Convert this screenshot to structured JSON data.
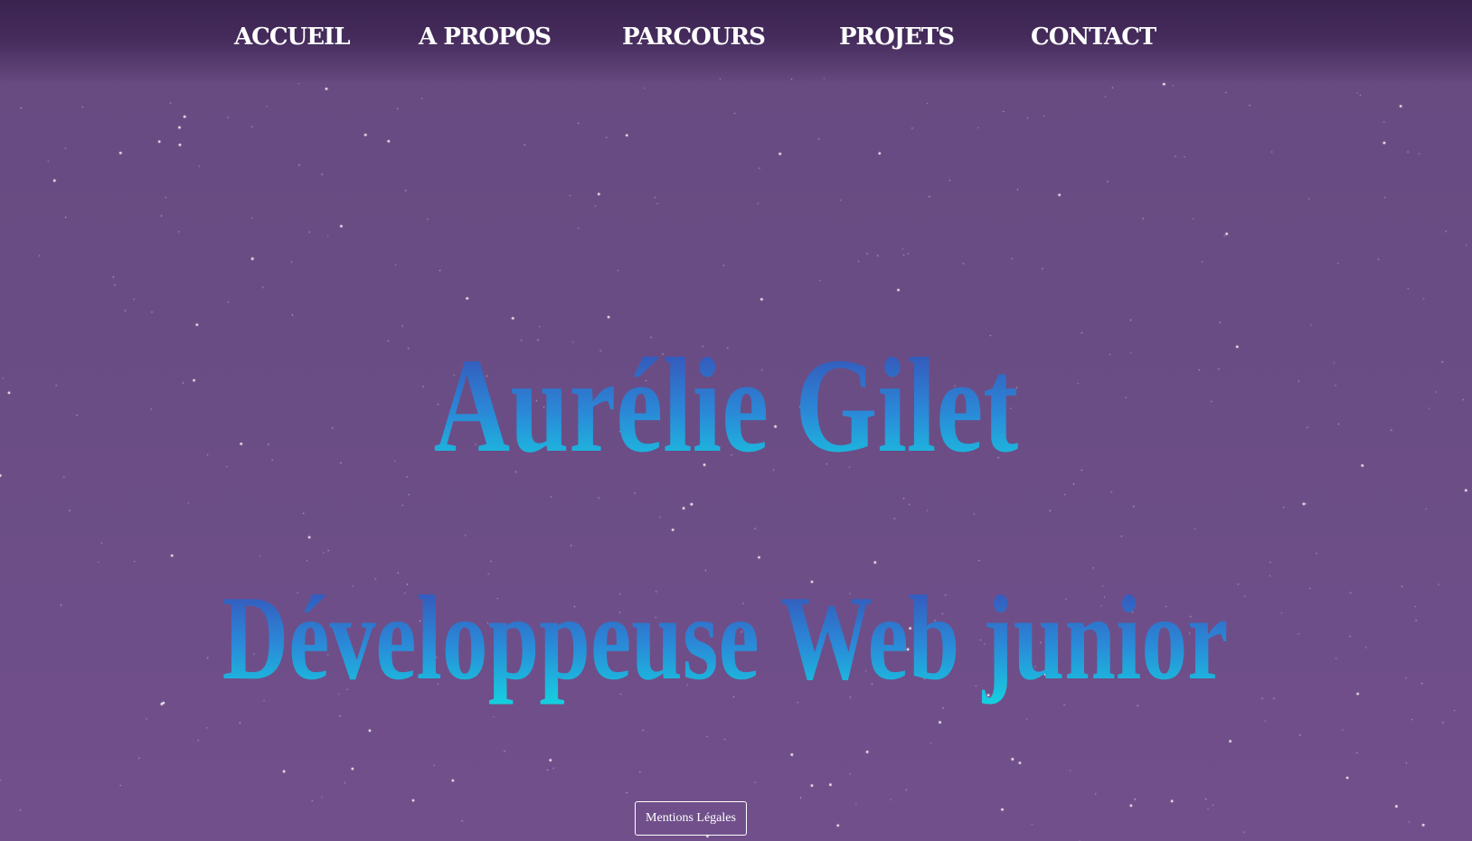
{
  "nav": {
    "items": [
      {
        "label": "ACCUEIL"
      },
      {
        "label": "A PROPOS"
      },
      {
        "label": "PARCOURS"
      },
      {
        "label": "PROJETS"
      },
      {
        "label": "CONTACT"
      }
    ]
  },
  "hero": {
    "name": "Aurélie Gilet",
    "title": "Développeuse Web junior"
  },
  "footer": {
    "legal_label": "Mentions Légales"
  },
  "colors": {
    "background": "#6b4d85",
    "navbar": "#3b2350",
    "gradient_top": "#3a44b0",
    "gradient_bottom": "#14d4e0",
    "star": "#ffffff"
  }
}
